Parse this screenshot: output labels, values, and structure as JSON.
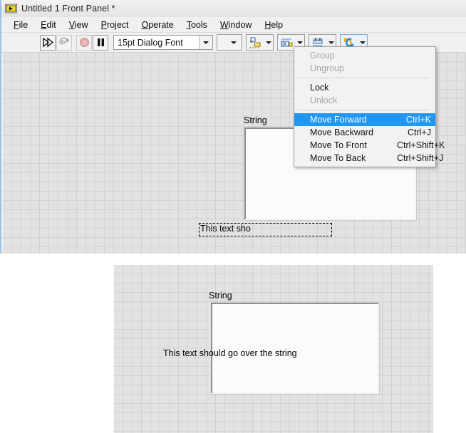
{
  "window": {
    "icon": "labview-vi-icon",
    "title": "Untitled 1 Front Panel *"
  },
  "menubar": {
    "items": [
      {
        "label": "File",
        "mnemonic": "F"
      },
      {
        "label": "Edit",
        "mnemonic": "E"
      },
      {
        "label": "View",
        "mnemonic": "V"
      },
      {
        "label": "Project",
        "mnemonic": "P"
      },
      {
        "label": "Operate",
        "mnemonic": "O"
      },
      {
        "label": "Tools",
        "mnemonic": "T"
      },
      {
        "label": "Window",
        "mnemonic": "W"
      },
      {
        "label": "Help",
        "mnemonic": "H"
      }
    ]
  },
  "toolbar": {
    "run_button": "run-arrow-icon",
    "run_continuously_button": "run-continuously-icon",
    "abort_button": "abort-execution-icon",
    "pause_button": "pause-icon",
    "font_combo": {
      "value": "15pt Dialog Font",
      "arrow": "chevron-down-icon"
    },
    "align_objects": {
      "icon": "align-objects-icon",
      "arrow": "chevron-down-icon"
    },
    "distribute_objects": {
      "icon": "distribute-objects-icon",
      "arrow": "chevron-down-icon"
    },
    "resize_objects": {
      "icon": "resize-objects-icon",
      "arrow": "chevron-down-icon"
    },
    "reorder_objects": {
      "icon": "reorder-objects-icon",
      "arrow": "chevron-down-icon"
    }
  },
  "popup_menu": {
    "items": [
      {
        "label": "Group",
        "accel": "",
        "state": "disabled"
      },
      {
        "label": "Ungroup",
        "accel": "",
        "state": "disabled"
      },
      {
        "separator": true
      },
      {
        "label": "Lock",
        "accel": "",
        "state": "enabled"
      },
      {
        "label": "Unlock",
        "accel": "",
        "state": "disabled"
      },
      {
        "separator": true
      },
      {
        "label": "Move Forward",
        "accel": "Ctrl+K",
        "state": "selected"
      },
      {
        "label": "Move Backward",
        "accel": "Ctrl+J",
        "state": "enabled"
      },
      {
        "label": "Move To Front",
        "accel": "Ctrl+Shift+K",
        "state": "enabled"
      },
      {
        "label": "Move To Back",
        "accel": "Ctrl+Shift+J",
        "state": "enabled"
      }
    ],
    "highlight_color": "#2196f3"
  },
  "front_panel_top": {
    "string_control_label": "String",
    "string_control_value": "",
    "free_label_text": "This text sho",
    "free_label_selected": true
  },
  "front_panel_bottom": {
    "string_control_label": "String",
    "string_control_value": "",
    "free_label_text": "This text should go over the string"
  },
  "colors": {
    "grid_background": "#e2e2e2",
    "grid_line": "#d2d2d2",
    "window_chrome": "#f0f0f0",
    "menu_highlight": "#2196f3",
    "control_face": "#fbfbfb"
  }
}
